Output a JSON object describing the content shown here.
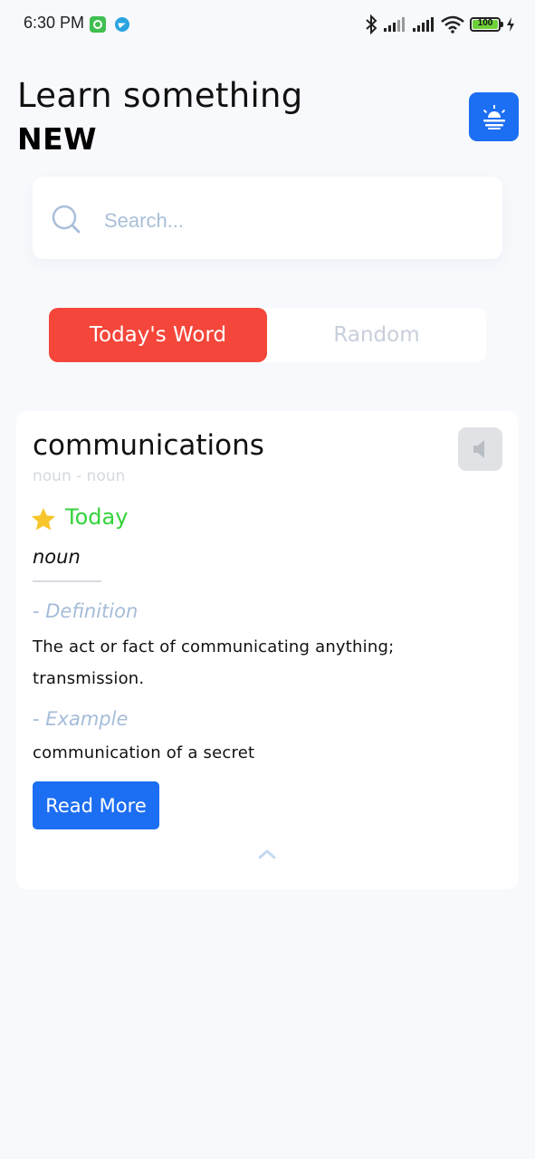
{
  "status_bar": {
    "time": "6:30 PM",
    "battery": "100",
    "icons": [
      "app-notification-icon",
      "telegram-icon",
      "bluetooth-icon",
      "signal-icon",
      "signal-icon",
      "wifi-icon",
      "battery-icon",
      "charging-icon"
    ]
  },
  "header": {
    "line1": "Learn something",
    "line2": "NEW",
    "theme_button_icon": "sunrise-icon"
  },
  "search": {
    "placeholder": "Search...",
    "value": ""
  },
  "tabs": [
    {
      "label": "Today's Word",
      "active": true
    },
    {
      "label": "Random",
      "active": false
    }
  ],
  "card": {
    "word": "communications",
    "subtitle": "noun - noun",
    "badge": "Today",
    "part_of_speech": "noun",
    "definition_label": "- Definition",
    "definition": "The act or fact of communicating anything; transmission.",
    "example_label": "- Example",
    "example": "communication of a secret",
    "read_more": "Read More"
  },
  "colors": {
    "accent_blue": "#1c6ef2",
    "accent_red": "#f4463a",
    "today_green": "#34d33a",
    "muted_label": "#a5bcd8"
  }
}
